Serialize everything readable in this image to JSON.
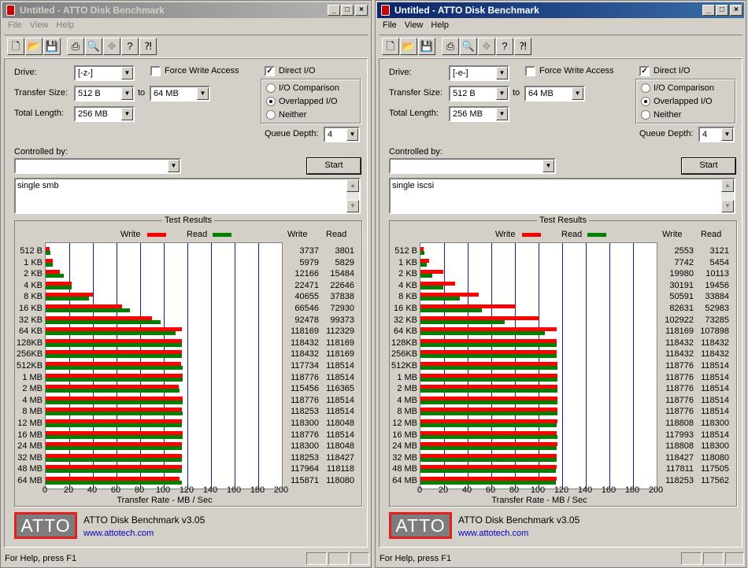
{
  "windows": [
    {
      "title": "Untitled - ATTO Disk Benchmark",
      "active": false,
      "menu": [
        "File",
        "View",
        "Help"
      ],
      "drive_label": "Drive:",
      "drive": "[-z-]",
      "force_write_label": "Force Write Access",
      "force_write": false,
      "direct_io_label": "Direct I/O",
      "direct_io": true,
      "transfer_size_label": "Transfer Size:",
      "transfer_from": "512 B",
      "to_label": "to",
      "transfer_to": "64 MB",
      "total_length_label": "Total Length:",
      "total_length": "256 MB",
      "io_options": [
        {
          "label": "I/O Comparison",
          "selected": false
        },
        {
          "label": "Overlapped I/O",
          "selected": true
        },
        {
          "label": "Neither",
          "selected": false
        }
      ],
      "queue_depth_label": "Queue Depth:",
      "queue_depth": "4",
      "controlled_by_label": "Controlled by:",
      "controlled_by": "",
      "start_label": "Start",
      "description": "single smb",
      "results": {
        "title": "Test Results",
        "write_legend": "Write",
        "read_legend": "Read",
        "col_write": "Write",
        "col_read": "Read",
        "xlabel": "Transfer Rate - MB / Sec"
      },
      "footer": {
        "logo_text": "ATTO",
        "app_version": "ATTO Disk Benchmark v3.05",
        "link": "www.attotech.com"
      },
      "status": "For Help, press F1"
    },
    {
      "title": "Untitled - ATTO Disk Benchmark",
      "active": true,
      "menu": [
        "File",
        "View",
        "Help"
      ],
      "drive_label": "Drive:",
      "drive": "[-e-]",
      "force_write_label": "Force Write Access",
      "force_write": false,
      "direct_io_label": "Direct I/O",
      "direct_io": true,
      "transfer_size_label": "Transfer Size:",
      "transfer_from": "512 B",
      "to_label": "to",
      "transfer_to": "64 MB",
      "total_length_label": "Total Length:",
      "total_length": "256 MB",
      "io_options": [
        {
          "label": "I/O Comparison",
          "selected": false
        },
        {
          "label": "Overlapped I/O",
          "selected": true
        },
        {
          "label": "Neither",
          "selected": false
        }
      ],
      "queue_depth_label": "Queue Depth:",
      "queue_depth": "4",
      "controlled_by_label": "Controlled by:",
      "controlled_by": "",
      "start_label": "Start",
      "description": "single iscsi",
      "results": {
        "title": "Test Results",
        "write_legend": "Write",
        "read_legend": "Read",
        "col_write": "Write",
        "col_read": "Read",
        "xlabel": "Transfer Rate - MB / Sec"
      },
      "footer": {
        "logo_text": "ATTO",
        "app_version": "ATTO Disk Benchmark v3.05",
        "link": "www.attotech.com"
      },
      "status": "For Help, press F1"
    }
  ],
  "chart_data": [
    {
      "type": "bar",
      "title": "Test Results",
      "xlabel": "Transfer Rate - MB / Sec",
      "xlim": [
        0,
        200
      ],
      "xticks": [
        0,
        20,
        40,
        60,
        80,
        100,
        120,
        140,
        160,
        180,
        200
      ],
      "categories": [
        "512 B",
        "1 KB",
        "2 KB",
        "4 KB",
        "8 KB",
        "16 KB",
        "32 KB",
        "64 KB",
        "128KB",
        "256KB",
        "512KB",
        "1 MB",
        "2 MB",
        "4 MB",
        "8 MB",
        "12 MB",
        "16 MB",
        "24 MB",
        "32 MB",
        "48 MB",
        "64 MB"
      ],
      "series": [
        {
          "name": "Write",
          "color": "#ff0000",
          "values": [
            3737,
            5979,
            12166,
            22471,
            40655,
            66546,
            92478,
            118169,
            118432,
            118432,
            117734,
            118776,
            115456,
            118776,
            118253,
            118300,
            118776,
            118300,
            118253,
            117964,
            115871
          ]
        },
        {
          "name": "Read",
          "color": "#008000",
          "values": [
            3801,
            5829,
            15484,
            22646,
            37838,
            72930,
            99373,
            112329,
            118169,
            118169,
            118514,
            118514,
            116365,
            118514,
            118514,
            118048,
            118514,
            118048,
            118427,
            118118,
            118080
          ]
        }
      ]
    },
    {
      "type": "bar",
      "title": "Test Results",
      "xlabel": "Transfer Rate - MB / Sec",
      "xlim": [
        0,
        200
      ],
      "xticks": [
        0,
        20,
        40,
        60,
        80,
        100,
        120,
        140,
        160,
        180,
        200
      ],
      "categories": [
        "512 B",
        "1 KB",
        "2 KB",
        "4 KB",
        "8 KB",
        "16 KB",
        "32 KB",
        "64 KB",
        "128KB",
        "256KB",
        "512KB",
        "1 MB",
        "2 MB",
        "4 MB",
        "8 MB",
        "12 MB",
        "16 MB",
        "24 MB",
        "32 MB",
        "48 MB",
        "64 MB"
      ],
      "series": [
        {
          "name": "Write",
          "color": "#ff0000",
          "values": [
            2553,
            7742,
            19980,
            30191,
            50591,
            82631,
            102922,
            118169,
            118432,
            118432,
            118776,
            118776,
            118776,
            118776,
            118776,
            118808,
            117993,
            118808,
            118427,
            117811,
            118253
          ]
        },
        {
          "name": "Read",
          "color": "#008000",
          "values": [
            3121,
            5454,
            10113,
            19456,
            33884,
            52983,
            73285,
            107898,
            118432,
            118432,
            118514,
            118514,
            118514,
            118514,
            118514,
            118300,
            118514,
            118300,
            118080,
            117505,
            117562
          ]
        }
      ]
    }
  ]
}
